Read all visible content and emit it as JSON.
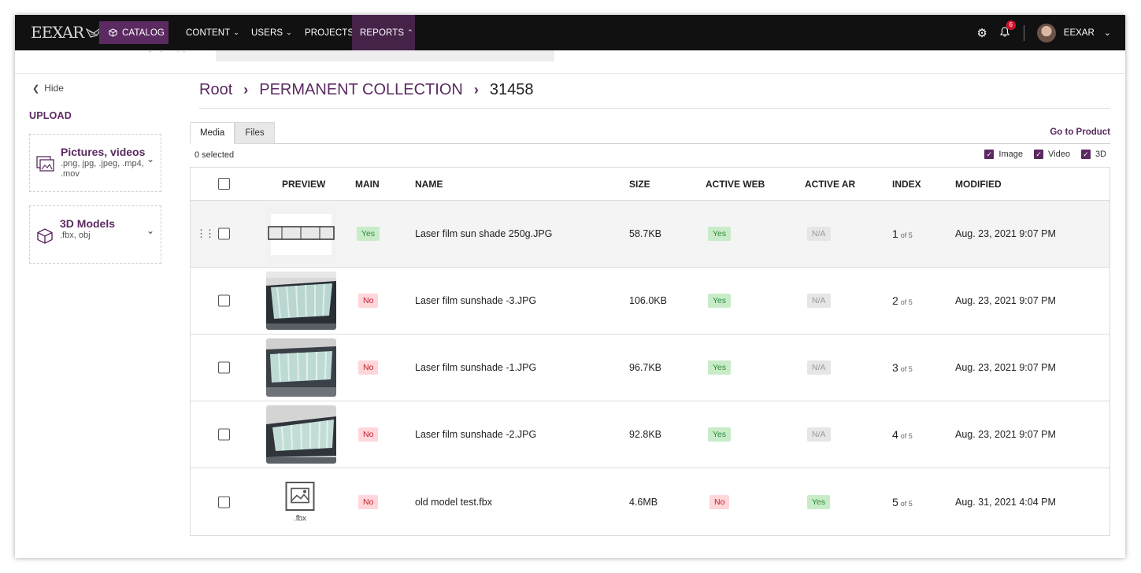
{
  "nav": {
    "logo": "EEXAR",
    "catalog": "CATALOG",
    "content": "CONTENT",
    "users": "USERS",
    "projects": "PROJECTS",
    "reports": "REPORTS",
    "notification_count": "6",
    "username": "EEXAR"
  },
  "ghost": {
    "page_title": "Media"
  },
  "sidebar": {
    "hide": "Hide",
    "upload_title": "UPLOAD",
    "cards": [
      {
        "title": "Pictures, videos",
        "subtitle": ".png, jpg, .jpeg, .mp4, .mov"
      },
      {
        "title": "3D Models",
        "subtitle": ".fbx, obj"
      }
    ]
  },
  "breadcrumb": [
    "Root",
    "PERMANENT COLLECTION",
    "31458"
  ],
  "tabs": [
    "Media",
    "Files"
  ],
  "go_to_product": "Go to Product",
  "selected_count": "0 selected",
  "filters": [
    "Image",
    "Video",
    "3D"
  ],
  "columns": [
    "PREVIEW",
    "MAIN",
    "NAME",
    "SIZE",
    "ACTIVE WEB",
    "ACTIVE AR",
    "INDEX",
    "MODIFIED"
  ],
  "rows": [
    {
      "main": "Yes",
      "name": "Laser film sun shade 250g.JPG",
      "size": "58.7KB",
      "active_web": "Yes",
      "active_ar": "N/A",
      "index": "1",
      "of": "of 5",
      "modified": "Aug. 23, 2021 9:07 PM"
    },
    {
      "main": "No",
      "name": "Laser film sunshade -3.JPG",
      "size": "106.0KB",
      "active_web": "Yes",
      "active_ar": "N/A",
      "index": "2",
      "of": "of 5",
      "modified": "Aug. 23, 2021 9:07 PM"
    },
    {
      "main": "No",
      "name": "Laser film sunshade -1.JPG",
      "size": "96.7KB",
      "active_web": "Yes",
      "active_ar": "N/A",
      "index": "3",
      "of": "of 5",
      "modified": "Aug. 23, 2021 9:07 PM"
    },
    {
      "main": "No",
      "name": "Laser film sunshade -2.JPG",
      "size": "92.8KB",
      "active_web": "Yes",
      "active_ar": "N/A",
      "index": "4",
      "of": "of 5",
      "modified": "Aug. 23, 2021 9:07 PM"
    },
    {
      "main": "No",
      "name": "old model test.fbx",
      "size": "4.6MB",
      "active_web": "No",
      "active_ar": "Yes",
      "index": "5",
      "of": "of 5",
      "modified": "Aug. 31, 2021 4:04 PM",
      "preview_label": ".fbx"
    }
  ],
  "colors": {
    "brand": "#5b2a61",
    "nav_bg": "#111111",
    "yes_bg": "#c8ecc8",
    "no_bg": "#ffd6d9"
  }
}
